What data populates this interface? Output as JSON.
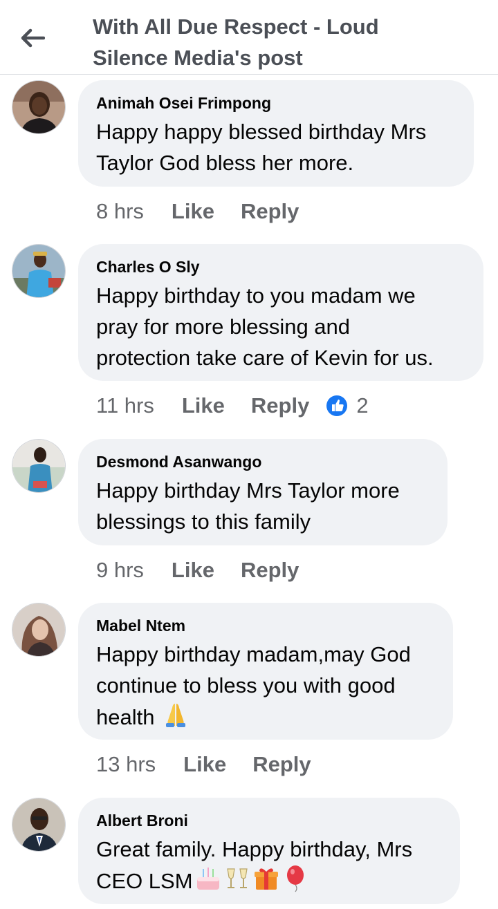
{
  "header": {
    "title_line1": "With All Due Respect - Loud",
    "title_line2": "Silence Media's post"
  },
  "comments": [
    {
      "author": "Animah Osei Frimpong",
      "lines": [
        "Happy happy blessed birthday Mrs",
        "Taylor God bless her more."
      ],
      "time": "8 hrs",
      "like_label": "Like",
      "reply_label": "Reply"
    },
    {
      "author": "Charles O Sly",
      "lines": [
        "Happy birthday to you madam we",
        "pray for more blessing and",
        "protection take care of Kevin for us."
      ],
      "time": "11 hrs",
      "like_label": "Like",
      "reply_label": "Reply",
      "reaction_count": "2"
    },
    {
      "author": "Desmond Asanwango",
      "lines": [
        "Happy birthday Mrs Taylor more",
        "blessings to this family"
      ],
      "time": "9 hrs",
      "like_label": "Like",
      "reply_label": "Reply"
    },
    {
      "author": "Mabel Ntem",
      "lines": [
        "Happy birthday madam,may God",
        "continue to bless you with good",
        "health"
      ],
      "time": "13 hrs",
      "like_label": "Like",
      "reply_label": "Reply"
    },
    {
      "author": "Albert Broni",
      "lines": [
        "Great family. Happy birthday, Mrs",
        "CEO LSM"
      ]
    }
  ],
  "colors": {
    "bubble": "#f0f2f5",
    "meta_text": "#65676b",
    "like_blue": "#1877f2"
  },
  "icons": {
    "back": "arrow-left-icon",
    "like_reaction": "thumbs-up-reaction-icon",
    "emoji_pray": "folded-hands-emoji",
    "emoji_cake": "birthday-cake-emoji",
    "emoji_glasses": "clinking-glasses-emoji",
    "emoji_gift": "gift-emoji",
    "emoji_balloon": "balloon-emoji"
  }
}
